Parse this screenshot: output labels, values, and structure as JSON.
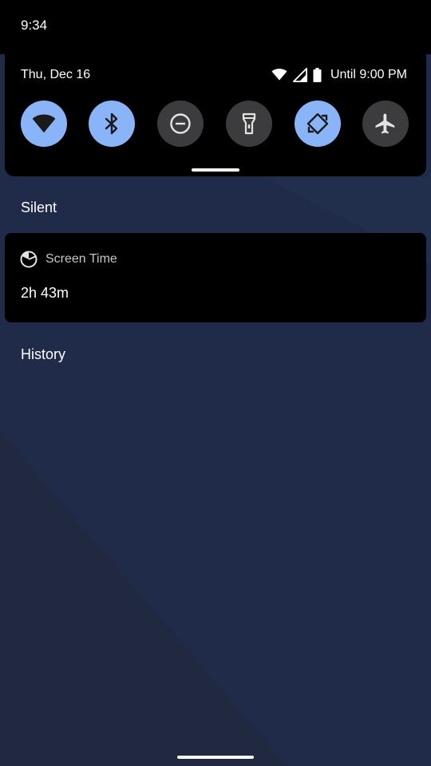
{
  "status_bar": {
    "time": "9:34"
  },
  "quick_settings": {
    "date": "Thu, Dec 16",
    "battery_text": "Until 9:00 PM",
    "status_icons": [
      "wifi-icon",
      "cell-signal-icon",
      "battery-icon"
    ],
    "tiles": [
      {
        "name": "wifi",
        "icon": "wifi-icon",
        "state": "on"
      },
      {
        "name": "bluetooth",
        "icon": "bluetooth-icon",
        "state": "on"
      },
      {
        "name": "do-not-disturb",
        "icon": "do-not-disturb-icon",
        "state": "off"
      },
      {
        "name": "flashlight",
        "icon": "flashlight-icon",
        "state": "off"
      },
      {
        "name": "auto-rotate",
        "icon": "auto-rotate-icon",
        "state": "on"
      },
      {
        "name": "airplane-mode",
        "icon": "airplane-icon",
        "state": "off"
      }
    ]
  },
  "notifications": {
    "silent_header": "Silent",
    "card": {
      "app_name": "Screen Time",
      "icon": "screen-time-icon",
      "content": "2h 43m"
    },
    "history_label": "History"
  },
  "colors": {
    "tile_on": "#8ab4f8",
    "tile_off": "#3c3c3e",
    "panel": "#000000",
    "wallpaper": "#1f2b48",
    "icon_on": "#1a1a1a",
    "icon_off": "#e3e3e3"
  }
}
